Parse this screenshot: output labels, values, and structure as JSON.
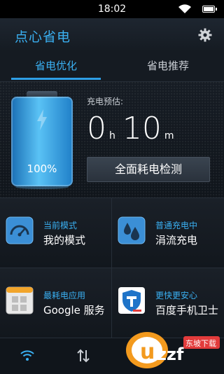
{
  "status_bar": {
    "time": "18:02"
  },
  "app": {
    "title": "点心省电"
  },
  "tabs": [
    {
      "label": "省电优化"
    },
    {
      "label": "省电推荐"
    }
  ],
  "battery": {
    "percent_text": "100%",
    "level": 1.0
  },
  "charge_estimate": {
    "label": "充电预估:",
    "hours": "0",
    "hours_unit": "h",
    "minutes": "10",
    "minutes_unit": "m"
  },
  "check_button": {
    "label": "全面耗电检测"
  },
  "cells": [
    {
      "label": "当前模式",
      "value": "我的模式",
      "icon": "speedometer-icon"
    },
    {
      "label": "普通充电中",
      "value": "涓流充电",
      "icon": "water-drops-icon"
    },
    {
      "label": "最耗电应用",
      "value": "Google 服务",
      "icon": "google-services-icon"
    },
    {
      "label": "更快更安心",
      "value": "百度手机卫士",
      "icon": "shield-icon"
    }
  ],
  "watermark": {
    "text": "uzzf.com",
    "tag": "东坡下载"
  },
  "colors": {
    "accent": "#3ab0f2",
    "background": "#0d1116"
  }
}
